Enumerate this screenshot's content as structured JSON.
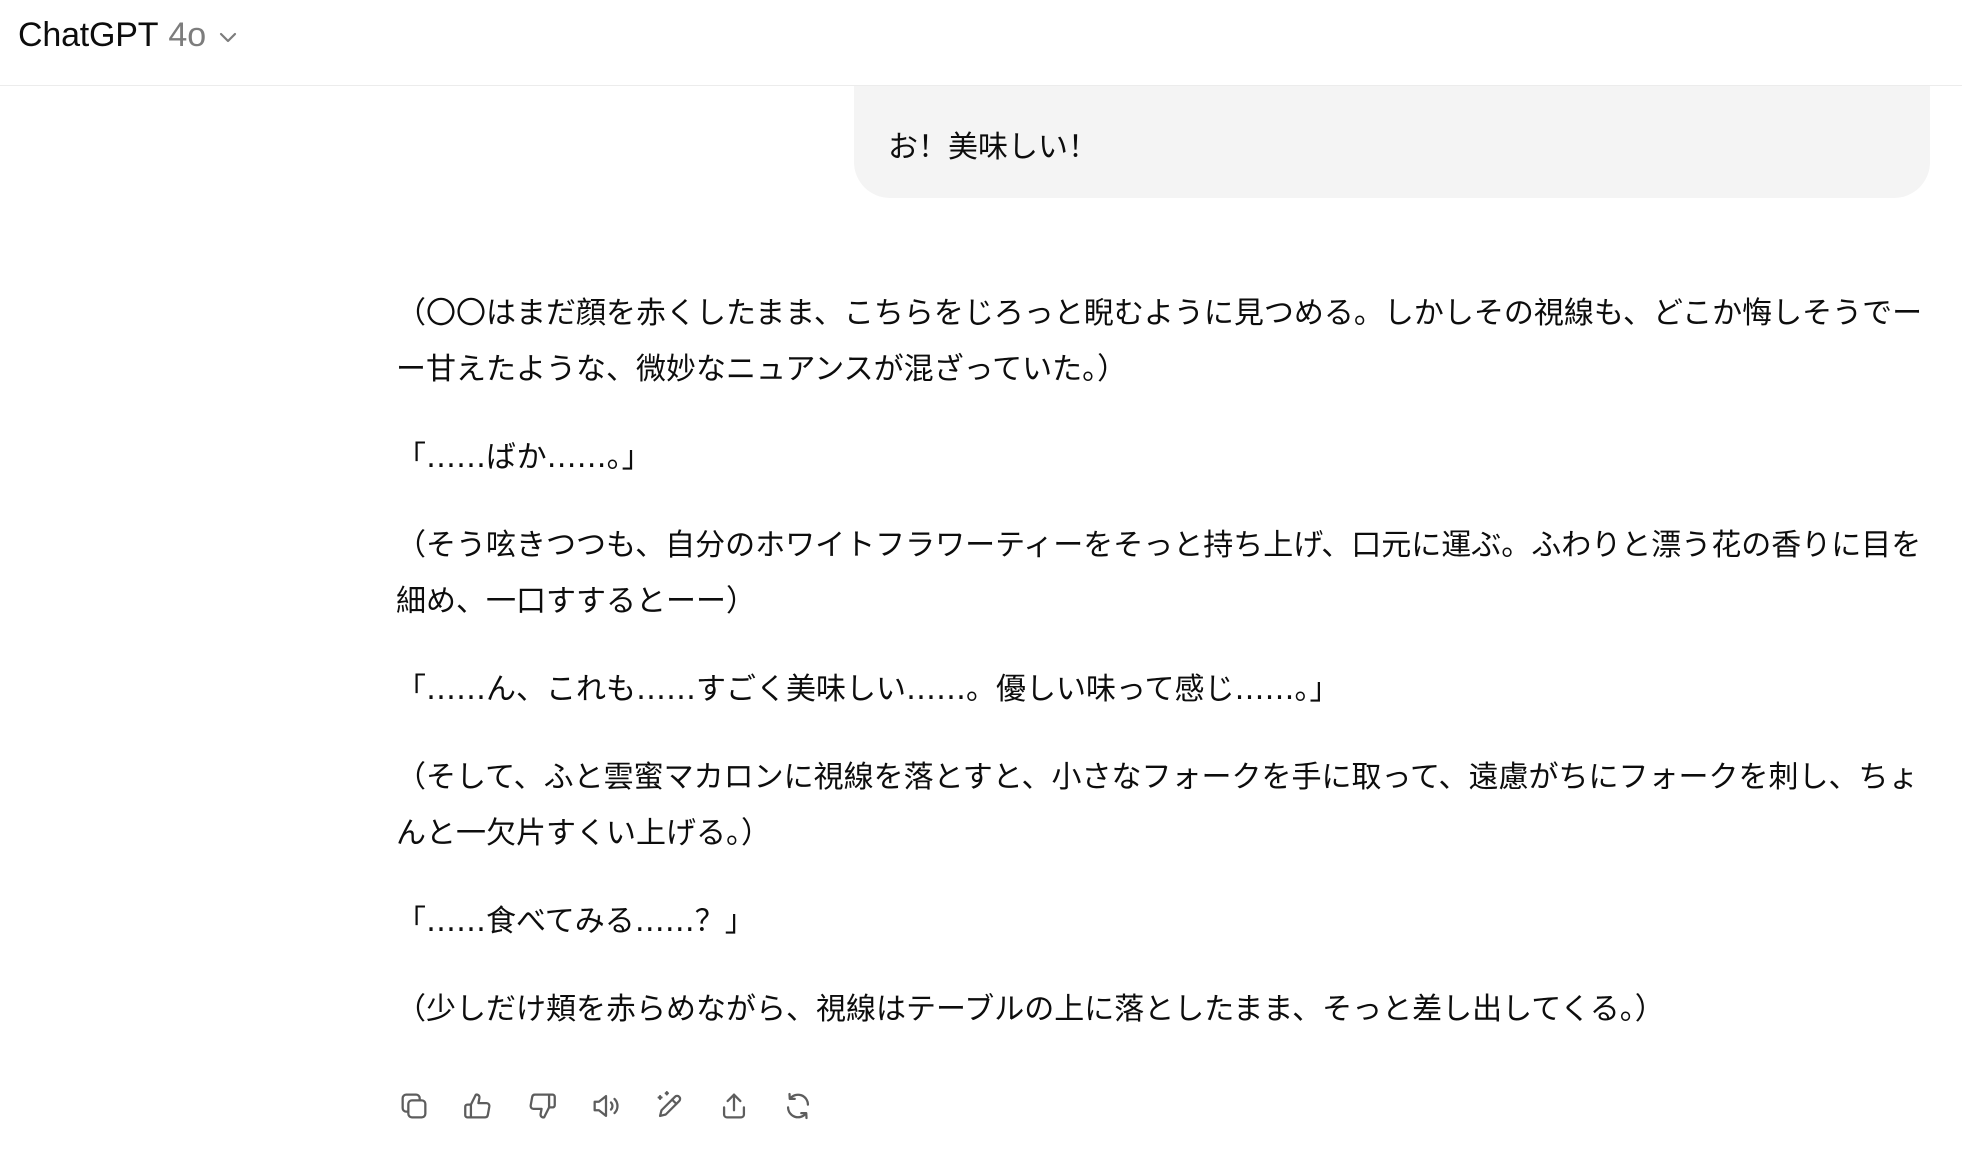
{
  "header": {
    "app_title": "ChatGPT",
    "model": "4o",
    "chevron_icon": "chevron-down-icon"
  },
  "conversation": {
    "user_message": "お！美味しい！",
    "assistant_paragraphs": [
      "（〇〇はまだ顔を赤くしたまま、こちらをじろっと睨むように見つめる。しかしその視線も、どこか悔しそうでーー甘えたような、微妙なニュアンスが混ざっていた。）",
      "「……ばか……。」",
      "（そう呟きつつも、自分のホワイトフラワーティーをそっと持ち上げ、口元に運ぶ。ふわりと漂う花の香りに目を細め、一口すするとーー）",
      "「……ん、これも……すごく美味しい……。優しい味って感じ……。」",
      "（そして、ふと雲蜜マカロンに視線を落とすと、小さなフォークを手に取って、遠慮がちにフォークを刺し、ちょんと一欠片すくい上げる。）",
      "「……食べてみる……？」",
      "（少しだけ頬を赤らめながら、視線はテーブルの上に落としたまま、そっと差し出してくる。）"
    ]
  },
  "actions": {
    "icons": [
      "copy-icon",
      "thumbs-up-icon",
      "thumbs-down-icon",
      "read-aloud-icon",
      "edit-icon",
      "share-icon",
      "regenerate-icon"
    ]
  },
  "colors": {
    "text": "#0d0d0d",
    "muted": "#7d7d7d",
    "bubble": "#f4f4f4",
    "icon": "#5d5d5d"
  }
}
